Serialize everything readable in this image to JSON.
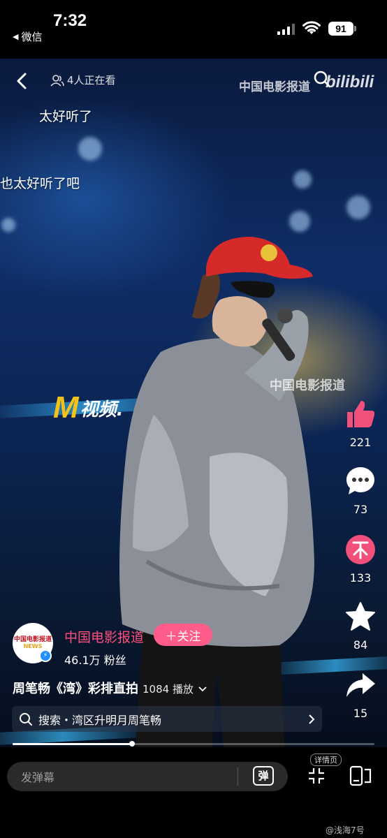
{
  "status_bar": {
    "time": "7:32",
    "back_app": "微信",
    "battery": "91"
  },
  "player": {
    "watchers": "4人正在看",
    "watermark_top": "中国电影报道",
    "watermark_mid": "中国电影报道",
    "brand_logo": "bilibili",
    "m_logo_letter": "M",
    "m_logo_text": "视频."
  },
  "danmaku": [
    "太好听了",
    "也太好听了吧"
  ],
  "actions": [
    {
      "name": "like",
      "icon": "thumbs-up-icon",
      "count": "221",
      "color": "#f0507a"
    },
    {
      "name": "comment",
      "icon": "comment-icon",
      "count": "73",
      "color": "#ffffff"
    },
    {
      "name": "coin",
      "icon": "coin-icon",
      "count": "133",
      "color": "#f0507a"
    },
    {
      "name": "favorite",
      "icon": "star-icon",
      "count": "84",
      "color": "#ffffff"
    },
    {
      "name": "share",
      "icon": "share-icon",
      "count": "15",
      "color": "#ffffff"
    }
  ],
  "uploader": {
    "name": "中国电影报道",
    "avatar_text": "中国电影报道",
    "avatar_sub": "NEWS",
    "follow_label": "＋关注",
    "fans": "46.1万 粉丝"
  },
  "video": {
    "title": "周笔畅《湾》彩排直拍",
    "plays": "1084 播放",
    "search_text": "搜索・湾区升明月周笔畅",
    "progress": 0.33
  },
  "bottom_bar": {
    "danmaku_placeholder": "发弹幕",
    "danmaku_toggle": "弹",
    "detail_tag": "详情页"
  },
  "credit": "@浅海7号",
  "colors": {
    "accent": "#ff5c8a",
    "brand_name": "#ff4f7a"
  }
}
